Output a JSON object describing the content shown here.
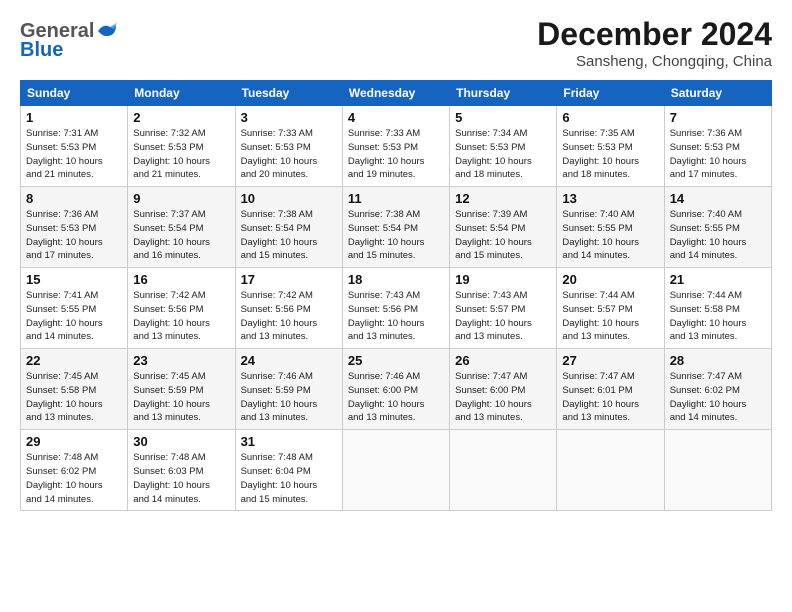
{
  "header": {
    "logo_line1": "General",
    "logo_line2": "Blue",
    "month": "December 2024",
    "location": "Sansheng, Chongqing, China"
  },
  "weekdays": [
    "Sunday",
    "Monday",
    "Tuesday",
    "Wednesday",
    "Thursday",
    "Friday",
    "Saturday"
  ],
  "weeks": [
    [
      {
        "day": "1",
        "rise": "7:31 AM",
        "set": "5:53 PM",
        "daylight": "10 hours and 21 minutes."
      },
      {
        "day": "2",
        "rise": "7:32 AM",
        "set": "5:53 PM",
        "daylight": "10 hours and 21 minutes."
      },
      {
        "day": "3",
        "rise": "7:33 AM",
        "set": "5:53 PM",
        "daylight": "10 hours and 20 minutes."
      },
      {
        "day": "4",
        "rise": "7:33 AM",
        "set": "5:53 PM",
        "daylight": "10 hours and 19 minutes."
      },
      {
        "day": "5",
        "rise": "7:34 AM",
        "set": "5:53 PM",
        "daylight": "10 hours and 18 minutes."
      },
      {
        "day": "6",
        "rise": "7:35 AM",
        "set": "5:53 PM",
        "daylight": "10 hours and 18 minutes."
      },
      {
        "day": "7",
        "rise": "7:36 AM",
        "set": "5:53 PM",
        "daylight": "10 hours and 17 minutes."
      }
    ],
    [
      {
        "day": "8",
        "rise": "7:36 AM",
        "set": "5:53 PM",
        "daylight": "10 hours and 17 minutes."
      },
      {
        "day": "9",
        "rise": "7:37 AM",
        "set": "5:54 PM",
        "daylight": "10 hours and 16 minutes."
      },
      {
        "day": "10",
        "rise": "7:38 AM",
        "set": "5:54 PM",
        "daylight": "10 hours and 15 minutes."
      },
      {
        "day": "11",
        "rise": "7:38 AM",
        "set": "5:54 PM",
        "daylight": "10 hours and 15 minutes."
      },
      {
        "day": "12",
        "rise": "7:39 AM",
        "set": "5:54 PM",
        "daylight": "10 hours and 15 minutes."
      },
      {
        "day": "13",
        "rise": "7:40 AM",
        "set": "5:55 PM",
        "daylight": "10 hours and 14 minutes."
      },
      {
        "day": "14",
        "rise": "7:40 AM",
        "set": "5:55 PM",
        "daylight": "10 hours and 14 minutes."
      }
    ],
    [
      {
        "day": "15",
        "rise": "7:41 AM",
        "set": "5:55 PM",
        "daylight": "10 hours and 14 minutes."
      },
      {
        "day": "16",
        "rise": "7:42 AM",
        "set": "5:56 PM",
        "daylight": "10 hours and 13 minutes."
      },
      {
        "day": "17",
        "rise": "7:42 AM",
        "set": "5:56 PM",
        "daylight": "10 hours and 13 minutes."
      },
      {
        "day": "18",
        "rise": "7:43 AM",
        "set": "5:56 PM",
        "daylight": "10 hours and 13 minutes."
      },
      {
        "day": "19",
        "rise": "7:43 AM",
        "set": "5:57 PM",
        "daylight": "10 hours and 13 minutes."
      },
      {
        "day": "20",
        "rise": "7:44 AM",
        "set": "5:57 PM",
        "daylight": "10 hours and 13 minutes."
      },
      {
        "day": "21",
        "rise": "7:44 AM",
        "set": "5:58 PM",
        "daylight": "10 hours and 13 minutes."
      }
    ],
    [
      {
        "day": "22",
        "rise": "7:45 AM",
        "set": "5:58 PM",
        "daylight": "10 hours and 13 minutes."
      },
      {
        "day": "23",
        "rise": "7:45 AM",
        "set": "5:59 PM",
        "daylight": "10 hours and 13 minutes."
      },
      {
        "day": "24",
        "rise": "7:46 AM",
        "set": "5:59 PM",
        "daylight": "10 hours and 13 minutes."
      },
      {
        "day": "25",
        "rise": "7:46 AM",
        "set": "6:00 PM",
        "daylight": "10 hours and 13 minutes."
      },
      {
        "day": "26",
        "rise": "7:47 AM",
        "set": "6:00 PM",
        "daylight": "10 hours and 13 minutes."
      },
      {
        "day": "27",
        "rise": "7:47 AM",
        "set": "6:01 PM",
        "daylight": "10 hours and 13 minutes."
      },
      {
        "day": "28",
        "rise": "7:47 AM",
        "set": "6:02 PM",
        "daylight": "10 hours and 14 minutes."
      }
    ],
    [
      {
        "day": "29",
        "rise": "7:48 AM",
        "set": "6:02 PM",
        "daylight": "10 hours and 14 minutes."
      },
      {
        "day": "30",
        "rise": "7:48 AM",
        "set": "6:03 PM",
        "daylight": "10 hours and 14 minutes."
      },
      {
        "day": "31",
        "rise": "7:48 AM",
        "set": "6:04 PM",
        "daylight": "10 hours and 15 minutes."
      },
      null,
      null,
      null,
      null
    ]
  ],
  "labels": {
    "sunrise": "Sunrise:",
    "sunset": "Sunset:",
    "daylight": "Daylight:"
  }
}
